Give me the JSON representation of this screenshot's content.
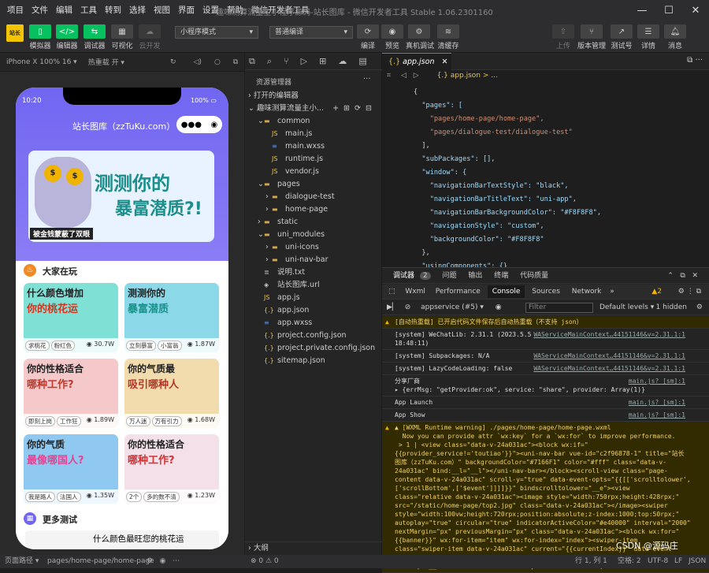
{
  "menu": [
    "项目",
    "文件",
    "编辑",
    "工具",
    "转到",
    "选择",
    "视图",
    "界面",
    "设置",
    "帮助",
    "微信开发者工具"
  ],
  "window_title": "趣味测算流量主小程序源码-站长图库 - 微信开发者工具 Stable 1.06.2301160",
  "toolbar": {
    "simulator": "模拟器",
    "editor": "编辑器",
    "debugger": "调试器",
    "visual": "可视化",
    "cloud": "云开发",
    "mode": "小程序模式",
    "compile": "普通编译",
    "compile_btn": "编译",
    "preview": "预览",
    "real_debug": "真机调试",
    "clear_cache": "清缓存",
    "upload": "上传",
    "version": "版本管理",
    "test": "测试号",
    "details": "详情",
    "message": "消息"
  },
  "sim": {
    "device": "iPhone X 100% 16 ▾",
    "hot_reload": "热重载 开 ▾"
  },
  "phone": {
    "time": "10:20",
    "battery": "100%",
    "title": "站长图库（zzTuKu.com）",
    "banner_text1": "测测你的",
    "banner_text2": "暴富潜质?!",
    "banner_caption": "被金钱蒙蔽了双眼",
    "section1": "大家在玩",
    "section2": "更多测试",
    "bottom_title": "什么颜色最旺您的桃花运",
    "cards": [
      {
        "title1": "什么颜色增加",
        "title2": "你的桃花运",
        "tag1": "求桃花",
        "tag2": "粉红色",
        "count": "30.7W"
      },
      {
        "title1": "测测你的",
        "title2": "暴富潜质",
        "tag1": "立刻暴富",
        "tag2": "小富翁",
        "count": "1.87W"
      },
      {
        "title1": "你的性格适合",
        "title2": "哪种工作?",
        "tag1": "即刻上岗",
        "tag2": "工作狂",
        "count": "1.89W"
      },
      {
        "title1": "你的气质最",
        "title2": "吸引哪种人",
        "tag1": "万人迷",
        "tag2": "万有引力",
        "count": "1.68W"
      },
      {
        "title1": "你的气质",
        "title2": "最像哪国人?",
        "tag1": "我是路人",
        "tag2": "法国人",
        "count": "1.35W"
      },
      {
        "title1": "你的性格适合",
        "title2": "哪种工作?",
        "tag1": "2个",
        "tag2": "多的数不清",
        "count": "1.23W"
      }
    ]
  },
  "explorer": {
    "header": "资源管理器",
    "open_editors": "打开的编辑器",
    "project": "趣味测算流量主小...",
    "outline": "大纲",
    "items": [
      {
        "name": "common",
        "kind": "folder",
        "depth": 1,
        "open": true
      },
      {
        "name": "main.js",
        "kind": "js",
        "depth": 2
      },
      {
        "name": "main.wxss",
        "kind": "wxss",
        "depth": 2
      },
      {
        "name": "runtime.js",
        "kind": "js",
        "depth": 2
      },
      {
        "name": "vendor.js",
        "kind": "js",
        "depth": 2
      },
      {
        "name": "pages",
        "kind": "folder",
        "depth": 1,
        "open": true
      },
      {
        "name": "dialogue-test",
        "kind": "folder",
        "depth": 2
      },
      {
        "name": "home-page",
        "kind": "folder",
        "depth": 2
      },
      {
        "name": "static",
        "kind": "folder",
        "depth": 1
      },
      {
        "name": "uni_modules",
        "kind": "folder",
        "depth": 1,
        "open": true
      },
      {
        "name": "uni-icons",
        "kind": "folder",
        "depth": 2
      },
      {
        "name": "uni-nav-bar",
        "kind": "folder",
        "depth": 2
      },
      {
        "name": "说明.txt",
        "kind": "txt",
        "depth": 1
      },
      {
        "name": "站长图库.url",
        "kind": "url",
        "depth": 1
      },
      {
        "name": "app.js",
        "kind": "js",
        "depth": 1
      },
      {
        "name": "app.json",
        "kind": "json",
        "depth": 1
      },
      {
        "name": "app.wxss",
        "kind": "wxss",
        "depth": 1
      },
      {
        "name": "project.config.json",
        "kind": "json",
        "depth": 1
      },
      {
        "name": "project.private.config.json",
        "kind": "json",
        "depth": 1
      },
      {
        "name": "sitemap.json",
        "kind": "json",
        "depth": 1
      }
    ]
  },
  "editor": {
    "tab": "app.json",
    "breadcrumb": "{.} app.json > ...",
    "lines": [
      "{",
      "  \"pages\": [",
      "    \"pages/home-page/home-page\",",
      "    \"pages/dialogue-test/dialogue-test\"",
      "  ],",
      "  \"subPackages\": [],",
      "  \"window\": {",
      "    \"navigationBarTextStyle\": \"black\",",
      "    \"navigationBarTitleText\": \"uni-app\",",
      "    \"navigationBarBackgroundColor\": \"#F8F8F8\",",
      "    \"navigationStyle\": \"custom\",",
      "    \"backgroundColor\": \"#F8F8F8\"",
      "  },",
      "  \"usingComponents\": {}"
    ]
  },
  "devtools": {
    "tabs": [
      "调试器",
      "2",
      "问题",
      "输出",
      "终端",
      "代码质量"
    ],
    "subtabs": [
      "Wxml",
      "Performance",
      "Console",
      "Sources",
      "Network",
      "»"
    ],
    "warn_count": "2",
    "context": "appservice (#5)",
    "filter": "Filter",
    "levels": "Default levels ▾",
    "hidden": "1 hidden",
    "logs": [
      {
        "text": "[自动热重载] 已开启代码文件保存后自动热重载（不支持 json）",
        "src": "",
        "type": "warn"
      },
      {
        "text": "[system] WeChatLib: 2.31.1 (2023.5.5\n18:48:11)",
        "src": "WAServiceMainContext…44151146&v=2.31.1:1",
        "type": "info"
      },
      {
        "text": "[system] Subpackages: N/A",
        "src": "WAServiceMainContext…44151146&v=2.31.1:1",
        "type": "info"
      },
      {
        "text": "[system] LazyCodeLoading: false",
        "src": "WAServiceMainContext…44151146&v=2.31.1:1",
        "type": "info"
      },
      {
        "text": "分享厂商\n▸ {errMsg: \"getProvider:ok\", service: \"share\", provider: Array(1)}",
        "src": "main.js? [sm]:1",
        "type": "info"
      },
      {
        "text": "App Launch",
        "src": "main.js? [sm]:1",
        "type": "info"
      },
      {
        "text": "App Show",
        "src": "main.js? [sm]:1",
        "type": "info"
      },
      {
        "text": "▲ [WXML Runtime warning] ./pages/home-page/home-page.wxml\n  Now you can provide attr `wx:key` for a `wx:for` to improve performance.\n > 1 | <view class=\"data-v-24a031ac\"><block wx:if=\"\n{{provider_service!='toutiao'}}\"><uni-nav-bar vue-id=\"c2f96878-1\" title=\"站长\n图库（zzTuKu.com）\" backgroundColor=\"#7166F1\" color=\"#fff\" class=\"data-v-\n24a031ac\" bind:__l=\"__l\"></uni-nav-bar></block><scroll-view class=\"page-\ncontent data-v-24a031ac\" scroll-y=\"true\" data-event-opts=\"{{[['scrolltolower',\n['scrollBottom',['$event']]]]}}\" bindscrolltolower=\"__e\"><view\nclass=\"relative data-v-24a031ac\"><image style=\"width:750rpx;height:428rpx;\"\nsrc=\"/static/home-page/top2.jpg\" class=\"data-v-24a031ac\"></image><swiper\nstyle=\"width:100vw;height:720rpx;position:absolute;z-index:1000;top:50rpx;\"\nautoplay=\"true\" circular=\"true\" indicatorActiveColor=\"#e40000\" interval=\"2000\"\nnextMargin=\"px\" previousMargin=\"px\" class=\"data-v-24a031ac\"><block wx:for=\"\n{{banner}}\" wx:for-item=\"item\" wx:for-index=\"index\"><swiper-item\nclass=\"swiper-item data-v-24a031ac\" current=\"{{currentIndex}}\" data-event-\nopts=\"{{[['tap',[['toAnswerPage',['$0'],[['banner','',index]]]]]]}}\"\nbindtap=\"__e\"><view class=\"ruleCard position: absolute; data-v-24a031ac\"",
        "src": "",
        "type": "warn"
      }
    ]
  },
  "status": {
    "path_label": "页面路径 ▾",
    "path": "pages/home-page/home-page",
    "errors": "⊗ 0 ⚠ 0",
    "pos": "行 1, 列 1",
    "spaces": "空格: 2",
    "enc": "UTF-8",
    "eol": "LF",
    "lang": "JSON",
    "watermark": "CSDN @源码庄"
  },
  "colors": {
    "accent_green": "#07c160",
    "nav_purple": "#7166F1",
    "orange": "#f08a24"
  }
}
